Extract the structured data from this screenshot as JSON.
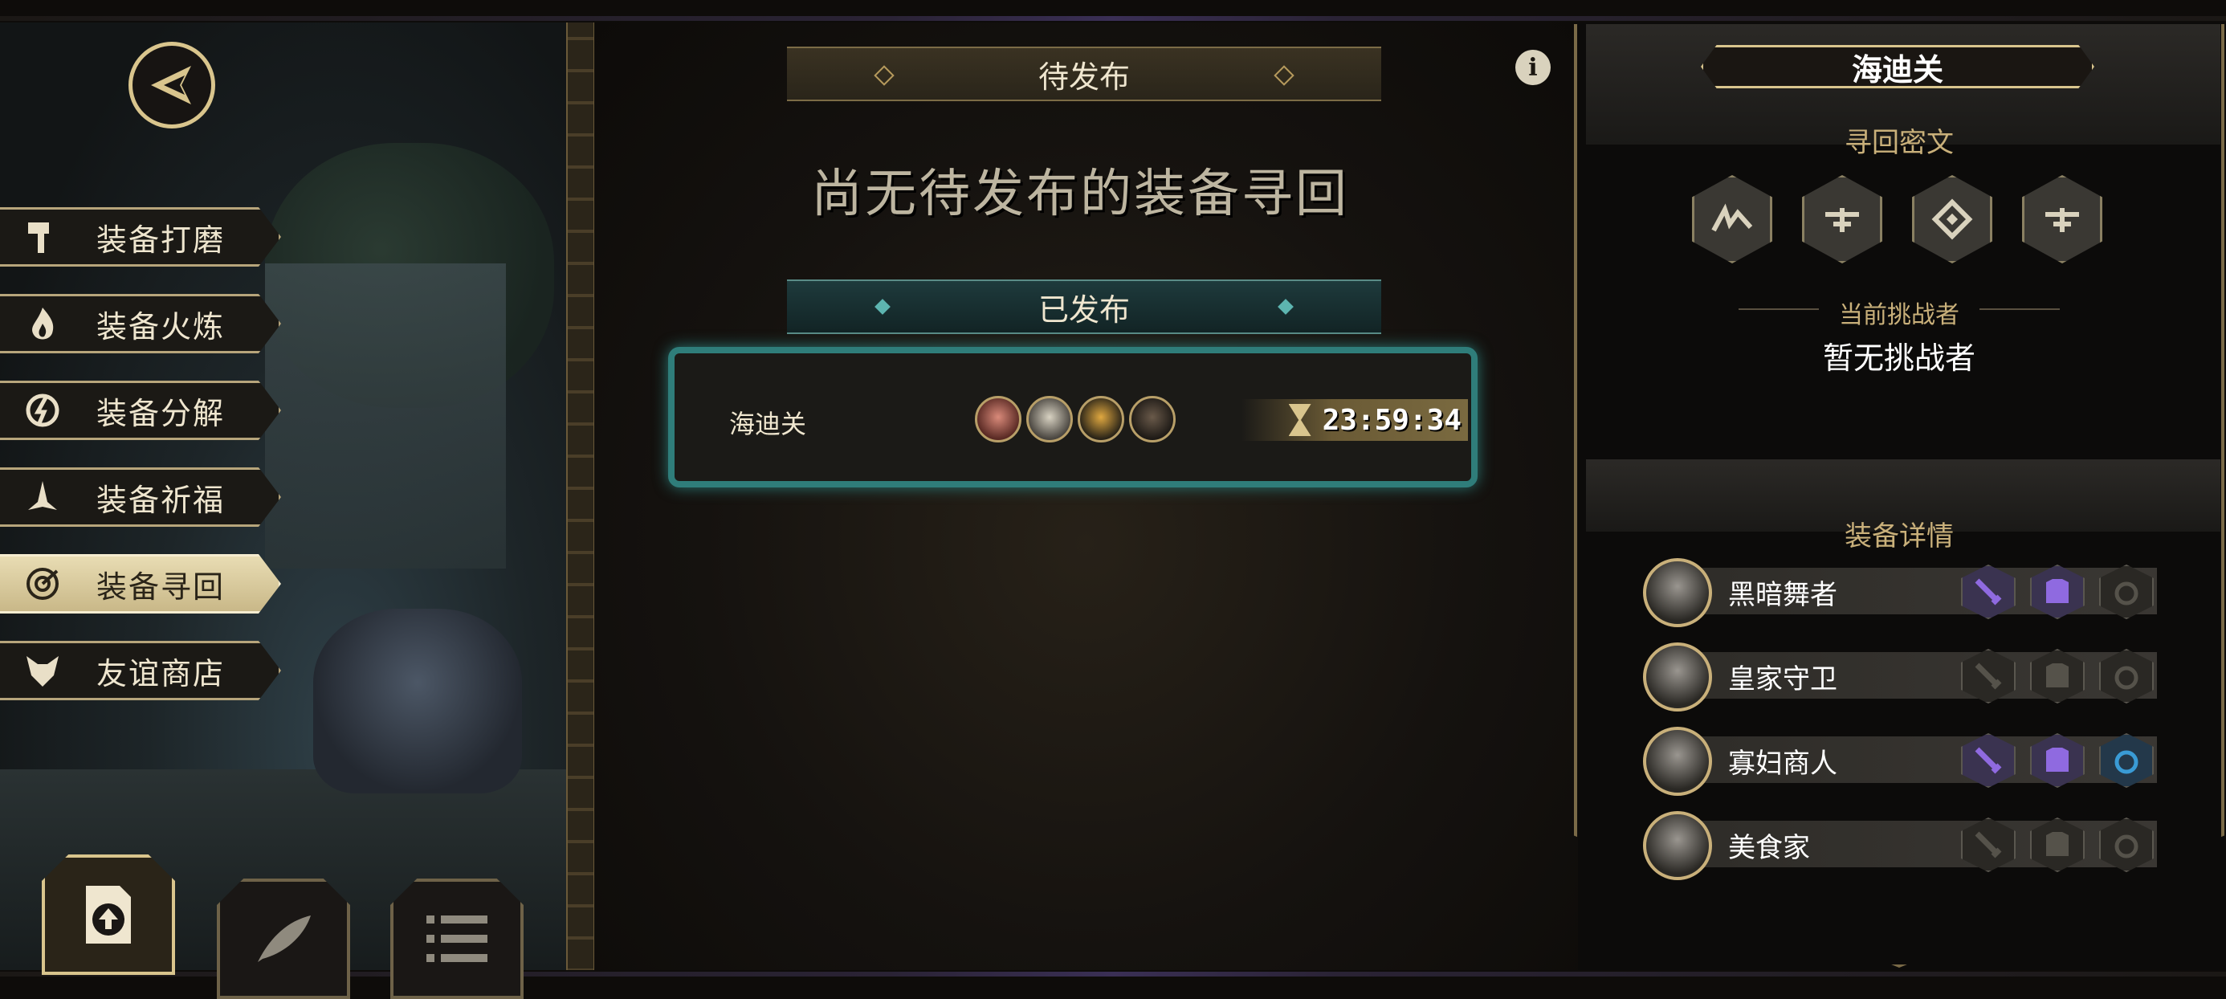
{
  "menu": {
    "items": [
      {
        "label": "装备打磨",
        "icon": "hammer-icon"
      },
      {
        "label": "装备火炼",
        "icon": "flame-icon"
      },
      {
        "label": "装备分解",
        "icon": "disassemble-icon"
      },
      {
        "label": "装备祈福",
        "icon": "prayer-hands-icon"
      },
      {
        "label": "装备寻回",
        "icon": "target-icon",
        "active": true
      },
      {
        "label": "友谊商店",
        "icon": "fox-icon"
      }
    ]
  },
  "bottom_buttons": [
    {
      "icon": "upload-document-icon",
      "active": true
    },
    {
      "icon": "feather-icon",
      "active": false
    },
    {
      "icon": "list-icon",
      "active": false
    }
  ],
  "pending": {
    "title": "待发布",
    "empty_message": "尚无待发布的装备寻回"
  },
  "published": {
    "title": "已发布",
    "entry": {
      "name": "海迪关",
      "portraits": [
        "rat-hero-portrait",
        "knight-hero-portrait",
        "bird-hero-portrait",
        "wolf-hero-portrait"
      ],
      "timer": "23:59:34"
    }
  },
  "right_panel": {
    "title": "海迪关",
    "cipher_title": "寻回密文",
    "runes": [
      "zigzag-rune-icon",
      "cross-rune-icon",
      "spiral-rune-icon",
      "cross-rune-icon"
    ],
    "challenger_label": "当前挑战者",
    "challenger_value": "暂无挑战者",
    "details_title": "装备详情",
    "heroes": [
      {
        "name": "黑暗舞者",
        "slots": [
          "purple",
          "purple",
          "empty"
        ]
      },
      {
        "name": "皇家守卫",
        "slots": [
          "empty",
          "empty",
          "empty"
        ]
      },
      {
        "name": "寡妇商人",
        "slots": [
          "purple",
          "purple",
          "blue"
        ]
      },
      {
        "name": "美食家",
        "slots": [
          "empty",
          "empty",
          "empty"
        ]
      }
    ]
  },
  "colors": {
    "gold": "#d9c58d",
    "teal": "#2f7d7a",
    "purple": "#7d55c7",
    "blue": "#3a9bd5"
  }
}
